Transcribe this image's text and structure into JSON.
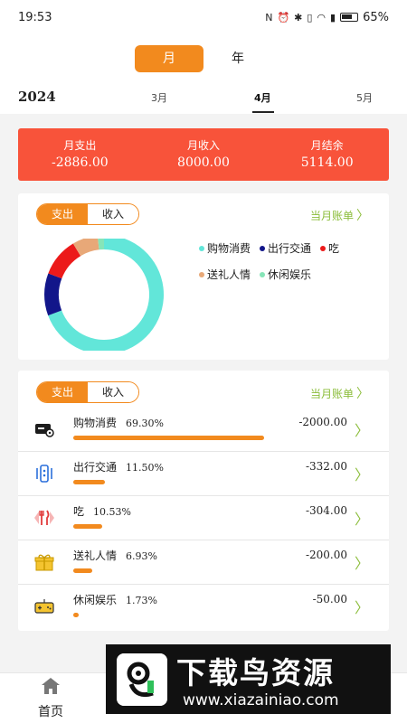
{
  "status_bar": {
    "time": "19:53",
    "battery": "65%"
  },
  "header": {
    "period_tabs": {
      "month": "月",
      "year": "年"
    },
    "year": "2024",
    "months": [
      "3月",
      "4月",
      "5月"
    ]
  },
  "summary": {
    "items": [
      {
        "label": "月支出",
        "value": "-2886.00"
      },
      {
        "label": "月收入",
        "value": "8000.00"
      },
      {
        "label": "月结余",
        "value": "5114.00"
      }
    ]
  },
  "chart_card": {
    "toggle": {
      "expense": "支出",
      "income": "收入"
    },
    "bill_link": "当月账单"
  },
  "chart_data": {
    "type": "pie",
    "series": [
      {
        "name": "购物消费",
        "value": 69.3,
        "color": "#62e6d9"
      },
      {
        "name": "出行交通",
        "value": 11.5,
        "color": "#12168a"
      },
      {
        "name": "吃",
        "value": 10.53,
        "color": "#ec1a1a"
      },
      {
        "name": "送礼人情",
        "value": 6.93,
        "color": "#e8a878"
      },
      {
        "name": "休闲娱乐",
        "value": 1.73,
        "color": "#86e5b8"
      }
    ]
  },
  "list_card": {
    "toggle": {
      "expense": "支出",
      "income": "收入"
    },
    "bill_link": "当月账单",
    "rows": [
      {
        "name": "购物消费",
        "pct": "69.30%",
        "amount": "-2000.00",
        "fraction": 0.693,
        "icon": "card-icon"
      },
      {
        "name": "出行交通",
        "pct": "11.50%",
        "amount": "-332.00",
        "fraction": 0.115,
        "icon": "transit-icon"
      },
      {
        "name": "吃",
        "pct": "10.53%",
        "amount": "-304.00",
        "fraction": 0.1053,
        "icon": "fork-knife-icon"
      },
      {
        "name": "送礼人情",
        "pct": "6.93%",
        "amount": "-200.00",
        "fraction": 0.0693,
        "icon": "gift-icon"
      },
      {
        "name": "休闲娱乐",
        "pct": "1.73%",
        "amount": "-50.00",
        "fraction": 0.0173,
        "icon": "gamepad-icon"
      }
    ]
  },
  "tabbar": {
    "home_label": "首页"
  },
  "watermark": {
    "title": "下载鸟资源",
    "url": "www.xiazainiao.com"
  },
  "colors": {
    "accent": "#f28a1e",
    "summary_bg": "#f8533a",
    "link": "#8bbd3a"
  }
}
